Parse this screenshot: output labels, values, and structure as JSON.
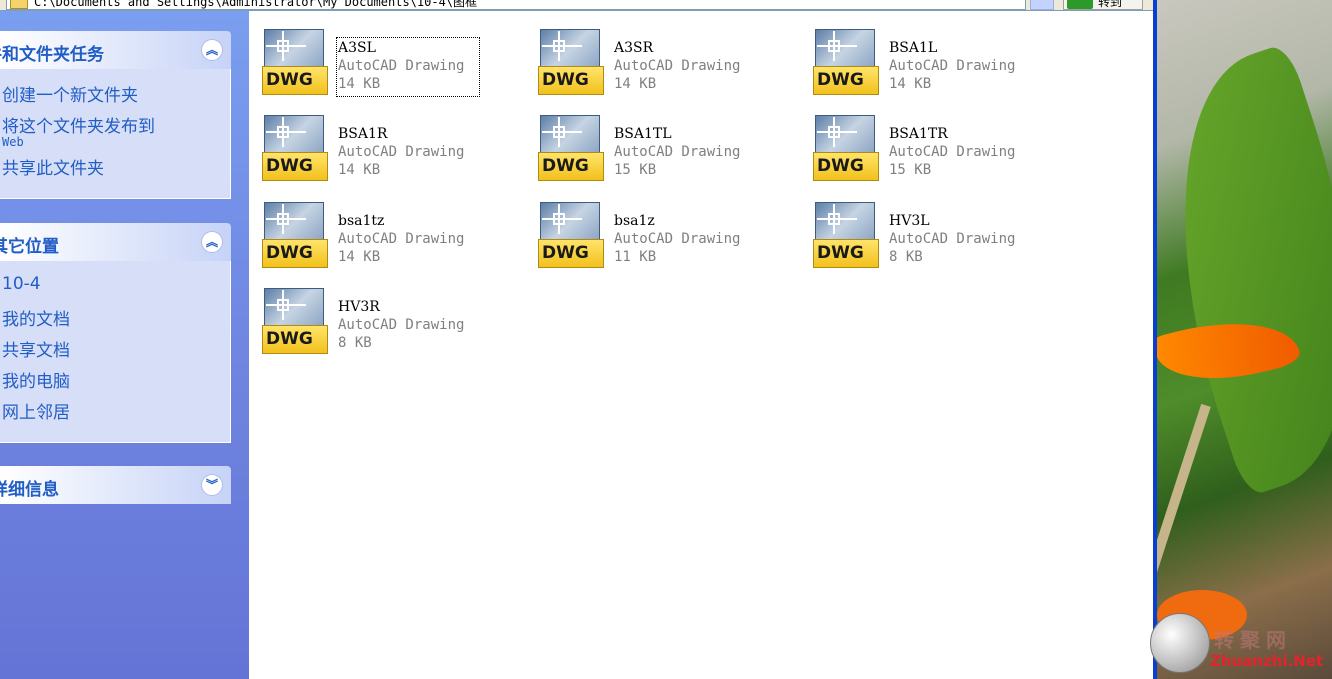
{
  "address_bar": {
    "path": "C:\\Documents and Settings\\Administrator\\My Documents\\10-4\\图框",
    "go_label": "转到"
  },
  "task_pane": {
    "file_folder_tasks": {
      "title": "文件和文件夹任务",
      "items": [
        "创建一个新文件夹",
        "将这个文件夹发布到",
        "Web",
        "共享此文件夹"
      ]
    },
    "other_places": {
      "title": "其它位置",
      "items": [
        "10-4",
        "我的文档",
        "共享文档",
        "我的电脑",
        "网上邻居"
      ]
    },
    "details": {
      "title": "详细信息"
    }
  },
  "files": [
    {
      "name": "A3SL",
      "type": "AutoCAD Drawing",
      "size": "14 KB",
      "icon": "dwg-file-icon",
      "icon_text": "DWG"
    },
    {
      "name": "A3SR",
      "type": "AutoCAD Drawing",
      "size": "14 KB",
      "icon": "dwg-file-icon",
      "icon_text": "DWG"
    },
    {
      "name": "BSA1L",
      "type": "AutoCAD Drawing",
      "size": "14 KB",
      "icon": "dwg-file-icon",
      "icon_text": "DWG"
    },
    {
      "name": "BSA1R",
      "type": "AutoCAD Drawing",
      "size": "14 KB",
      "icon": "dwg-file-icon",
      "icon_text": "DWG"
    },
    {
      "name": "BSA1TL",
      "type": "AutoCAD Drawing",
      "size": "15 KB",
      "icon": "dwg-file-icon",
      "icon_text": "DWG"
    },
    {
      "name": "BSA1TR",
      "type": "AutoCAD Drawing",
      "size": "15 KB",
      "icon": "dwg-file-icon",
      "icon_text": "DWG"
    },
    {
      "name": "bsa1tz",
      "type": "AutoCAD Drawing",
      "size": "14 KB",
      "icon": "dwg-file-icon",
      "icon_text": "DWG"
    },
    {
      "name": "bsa1z",
      "type": "AutoCAD Drawing",
      "size": "11 KB",
      "icon": "dwg-file-icon",
      "icon_text": "DWG"
    },
    {
      "name": "HV3L",
      "type": "AutoCAD Drawing",
      "size": "8 KB",
      "icon": "dwg-file-icon",
      "icon_text": "DWG"
    },
    {
      "name": "HV3R",
      "type": "AutoCAD Drawing",
      "size": "8 KB",
      "icon": "dwg-file-icon",
      "icon_text": "DWG"
    }
  ],
  "watermark": {
    "cn": "转聚网",
    "en": "Zhuanzhi.Net"
  },
  "colors": {
    "task_pane_bg": "#7a9ef0",
    "task_link": "#215dc6",
    "window_border": "#0a3ed1"
  }
}
